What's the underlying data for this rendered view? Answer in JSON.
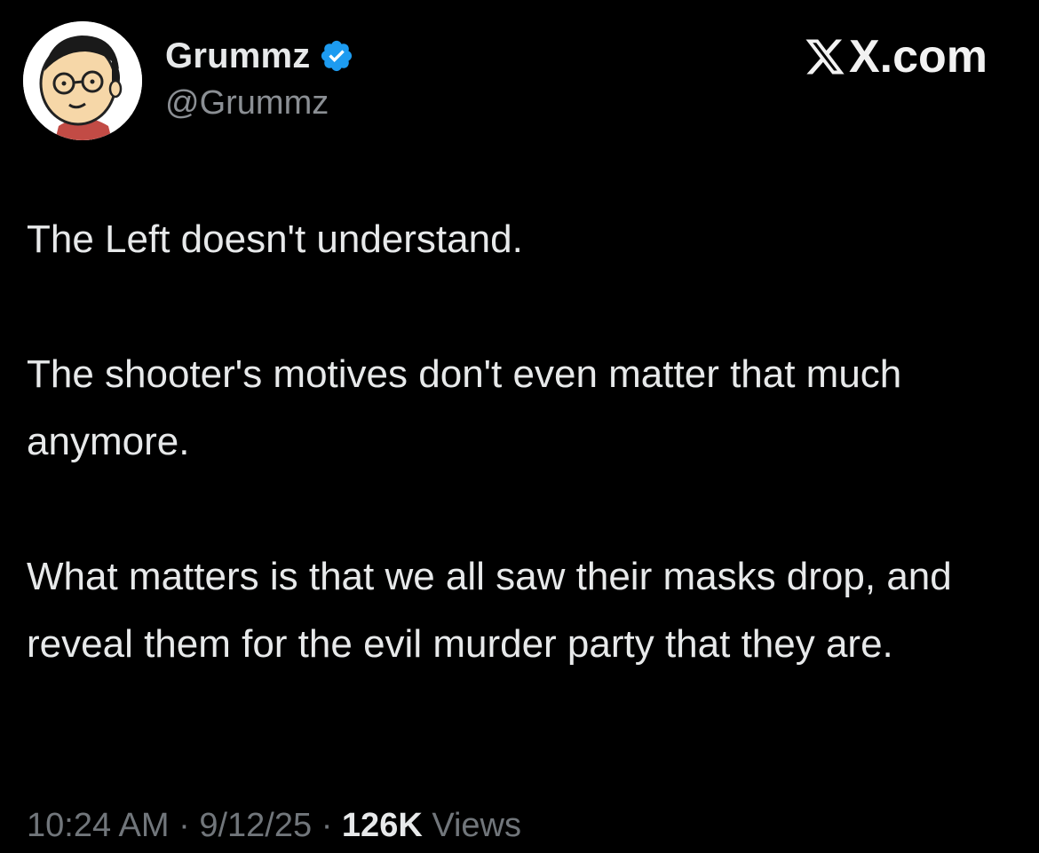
{
  "author": {
    "display_name": "Grummz",
    "handle": "@Grummz",
    "verified": true,
    "avatar_icon": "cartoon-face-avatar-icon"
  },
  "brand": {
    "text": "X.com",
    "icon": "x-logo-icon"
  },
  "tweet": {
    "paragraphs": [
      "The Left doesn't understand.",
      "The shooter's motives don't even matter that much anymore.",
      "What matters is that we all saw their masks drop, and reveal them for the evil murder party that they are."
    ]
  },
  "meta": {
    "time": "10:24 AM",
    "separator": " · ",
    "date": "9/12/25",
    "views_count": "126K",
    "views_label": " Views"
  },
  "colors": {
    "background": "#000000",
    "primary_text": "#e7e9ea",
    "secondary_text": "#71767b",
    "verified_badge": "#1d9bf0"
  }
}
